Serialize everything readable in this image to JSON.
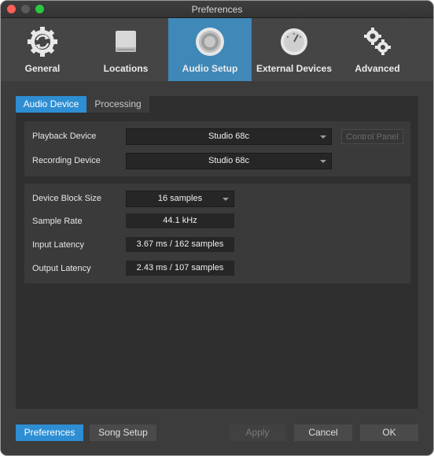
{
  "window": {
    "title": "Preferences"
  },
  "toolbar": {
    "items": [
      {
        "label": "General",
        "icon": "general-sync-icon"
      },
      {
        "label": "Locations",
        "icon": "drive-icon"
      },
      {
        "label": "Audio Setup",
        "icon": "speaker-icon"
      },
      {
        "label": "External Devices",
        "icon": "dial-icon"
      },
      {
        "label": "Advanced",
        "icon": "gears-icon"
      }
    ],
    "active_index": 2
  },
  "subtabs": [
    "Audio Device",
    "Processing"
  ],
  "audio_device": {
    "playback_label": "Playback Device",
    "playback_value": "Studio 68c",
    "control_panel": "Control Panel",
    "recording_label": "Recording Device",
    "recording_value": "Studio 68c"
  },
  "settings": {
    "block_size_label": "Device Block Size",
    "block_size_value": "16 samples",
    "sample_rate_label": "Sample Rate",
    "sample_rate_value": "44.1 kHz",
    "input_latency_label": "Input Latency",
    "input_latency_value": "3.67 ms / 162 samples",
    "output_latency_label": "Output Latency",
    "output_latency_value": "2.43 ms / 107 samples"
  },
  "footer": {
    "preferences": "Preferences",
    "song_setup": "Song Setup",
    "apply": "Apply",
    "cancel": "Cancel",
    "ok": "OK"
  },
  "colors": {
    "accent": "#2e8ed3",
    "active_toolbar": "#3f88b8"
  }
}
